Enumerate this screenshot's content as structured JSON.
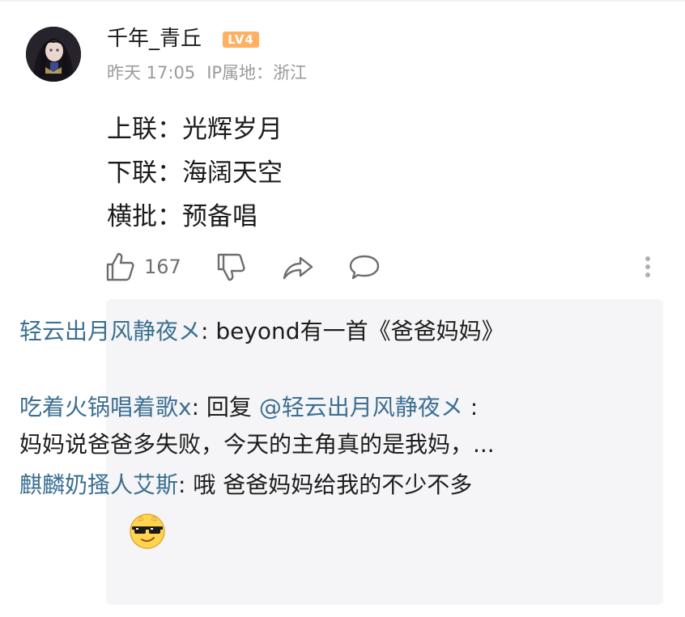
{
  "post": {
    "username": "千年_青丘",
    "level_badge": "LV4",
    "time": "昨天 17:05",
    "ip_location": "IP属地：浙江",
    "content": {
      "line1": "上联：光辉岁月",
      "line2": "下联：海阔天空",
      "line3": "横批：预备唱"
    },
    "actions": {
      "like_count": "167",
      "like_icon": "thumbs-up-icon",
      "dislike_icon": "thumbs-down-icon",
      "share_icon": "share-arrow-icon",
      "comment_icon": "comment-bubble-icon",
      "more_icon": "more-vertical-icon"
    }
  },
  "replies": [
    {
      "name": "轻云出月风静夜メ",
      "separator": ": ",
      "text": "beyond有一首《爸爸妈妈》"
    },
    {
      "name": "吃着火锅唱着歌x",
      "separator": ": ",
      "reply_prefix": "回复 ",
      "mention": "@轻云出月风静夜メ",
      "mention_suffix": " :",
      "text": "妈妈说爸爸多失败，今天的主角真的是我妈，..."
    },
    {
      "name": "麒麟奶搔人艾斯",
      "separator": ": ",
      "text": "哦 爸爸妈妈给我的不少不多",
      "emoji": "cool-sunglasses-emoji"
    }
  ],
  "colors": {
    "name_link": "#3b6f92",
    "meta_gray": "#9a9a9a",
    "badge_orange": "#ffb060",
    "reply_bg": "#f5f5f7"
  }
}
